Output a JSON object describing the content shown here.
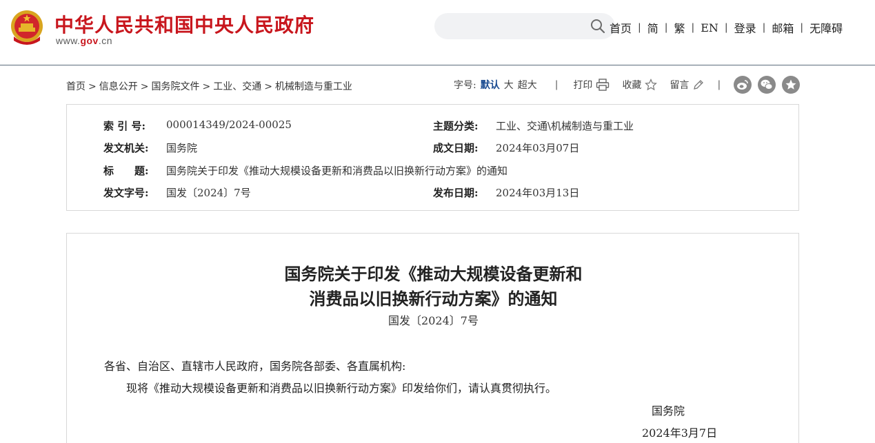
{
  "header": {
    "site_title": "中华人民共和国中央人民政府",
    "url_prefix": "www.",
    "url_gov": "gov",
    "url_suffix": ".cn",
    "search_placeholder": "",
    "nav": [
      "首页",
      "简",
      "繁",
      "EN",
      "登录",
      "邮箱",
      "无障碍"
    ]
  },
  "breadcrumb": [
    "首页",
    "信息公开",
    "国务院文件",
    "工业、交通",
    "机械制造与重工业"
  ],
  "tools": {
    "font_label": "字号:",
    "font_sizes": [
      "默认",
      "大",
      "超大"
    ],
    "print": "打印",
    "favorite": "收藏",
    "comment": "留言"
  },
  "share_icons": [
    "weibo-icon",
    "wechat-icon",
    "favorite-star-icon"
  ],
  "meta": {
    "index_no_label": "索 引 号:",
    "index_no": "000014349/2024-00025",
    "topic_label": "主题分类:",
    "topic": "工业、交通\\机械制造与重工业",
    "issuer_label": "发文机关:",
    "issuer": "国务院",
    "written_date_label": "成文日期:",
    "written_date": "2024年03月07日",
    "title_label": "标　　题:",
    "title": "国务院关于印发《推动大规模设备更新和消费品以旧换新行动方案》的通知",
    "doc_no_label": "发文字号:",
    "doc_no": "国发〔2024〕7号",
    "publish_date_label": "发布日期:",
    "publish_date": "2024年03月13日"
  },
  "document": {
    "title_line1": "国务院关于印发《推动大规模设备更新和",
    "title_line2": "消费品以旧换新行动方案》的通知",
    "doc_no": "国发〔2024〕7号",
    "salutation": "各省、自治区、直辖市人民政府，国务院各部委、各直属机构:",
    "body": "现将《推动大规模设备更新和消费品以旧换新行动方案》印发给你们，请认真贯彻执行。",
    "signer": "国务院",
    "sign_date": "2024年3月7日"
  },
  "colors": {
    "brand_red": "#c8161d",
    "link_blue": "#1a4b91",
    "icon_gray": "#8a8a8a"
  }
}
